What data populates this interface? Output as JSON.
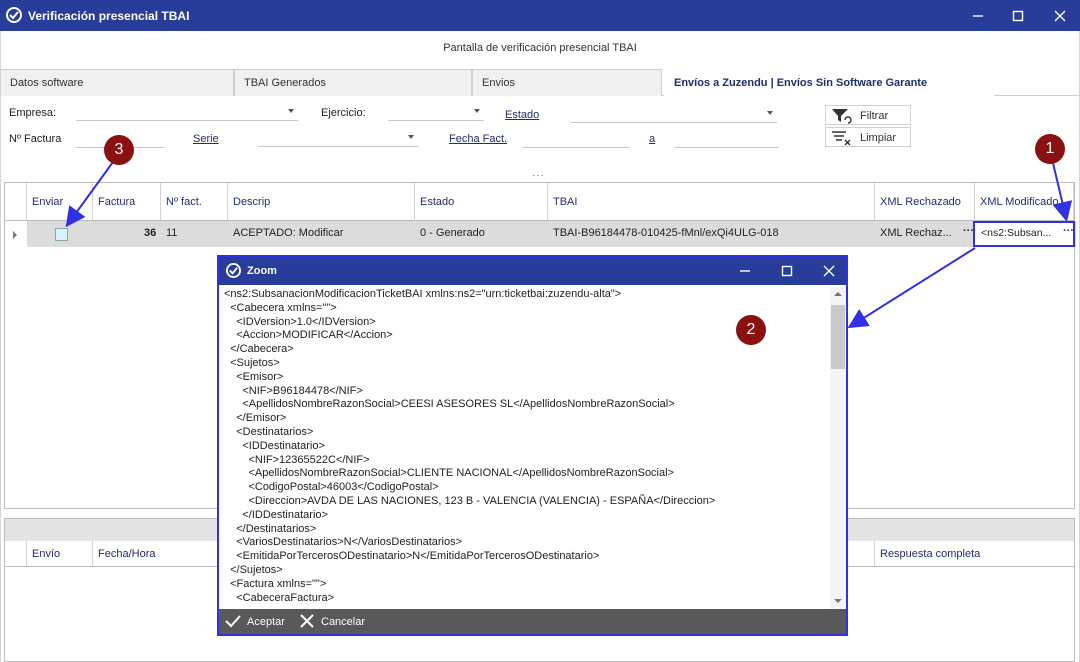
{
  "window": {
    "title": "Verificación presencial TBAI"
  },
  "header": {
    "caption": "Pantalla de verificación presencial TBAI"
  },
  "tabs": [
    {
      "label": "Datos software"
    },
    {
      "label": "TBAI Generados"
    },
    {
      "label": "Envios"
    },
    {
      "label": "Envíos a Zuzendu | Envíos Sin Software Garante"
    }
  ],
  "filters": {
    "empresa_label": "Empresa:",
    "ejercicio_label": "Ejercicio:",
    "estado_label": "Estado",
    "nfactura_label": "Nº Factura",
    "serie_label": "Serie",
    "fecha_label": "Fecha Fact.",
    "a_label": "a",
    "filtrar": "Filtrar",
    "limpiar": "Limpiar"
  },
  "grid": {
    "headers": [
      "Enviar",
      "Factura",
      "Nº fact.",
      "Descrip",
      "Estado",
      "TBAI",
      "XML Rechazado",
      "XML Modificado"
    ],
    "row": {
      "factura": "36",
      "nfact": "11",
      "descrip": "ACEPTADO: Modificar",
      "estado": "0 - Generado",
      "tbai": "TBAI-B96184478-010425-fMnl/exQi4ULG-018",
      "xml_rechazado": "XML Rechaz...",
      "xml_modificado": "<ns2:Subsan..."
    }
  },
  "grid2": {
    "headers": [
      "Envío",
      "Fecha/Hora",
      "Respuesta completa"
    ]
  },
  "zoom": {
    "title": "Zoom",
    "lines": [
      "<ns2:SubsanacionModificacionTicketBAI xmlns:ns2=\"urn:ticketbai:zuzendu-alta\">",
      "  <Cabecera xmlns=\"\">",
      "    <IDVersion>1.0</IDVersion>",
      "    <Accion>MODIFICAR</Accion>",
      "  </Cabecera>",
      "  <Sujetos>",
      "    <Emisor>",
      "      <NIF>B96184478</NIF>",
      "      <ApellidosNombreRazonSocial>CEESI ASESORES SL</ApellidosNombreRazonSocial>",
      "    </Emisor>",
      "    <Destinatarios>",
      "      <IDDestinatario>",
      "        <NIF>12365522C</NIF>",
      "        <ApellidosNombreRazonSocial>CLIENTE NACIONAL</ApellidosNombreRazonSocial>",
      "        <CodigoPostal>46003</CodigoPostal>",
      "        <Direccion>AVDA DE LAS NACIONES, 123 B - VALENCIA (VALENCIA) - ESPAÑA</Direccion>",
      "      </IDDestinatario>",
      "    </Destinatarios>",
      "    <VariosDestinatarios>N</VariosDestinatarios>",
      "    <EmitidaPorTercerosODestinatario>N</EmitidaPorTercerosODestinatario>",
      "  </Sujetos>",
      "  <Factura xmlns=\"\">",
      "    <CabeceraFactura>"
    ],
    "accept": "Aceptar",
    "cancel": "Cancelar"
  },
  "callouts": [
    "1",
    "2",
    "3"
  ],
  "colors": {
    "titlebar": "#283c9a",
    "callout": "#8b1111",
    "arrow": "#3030e6"
  }
}
